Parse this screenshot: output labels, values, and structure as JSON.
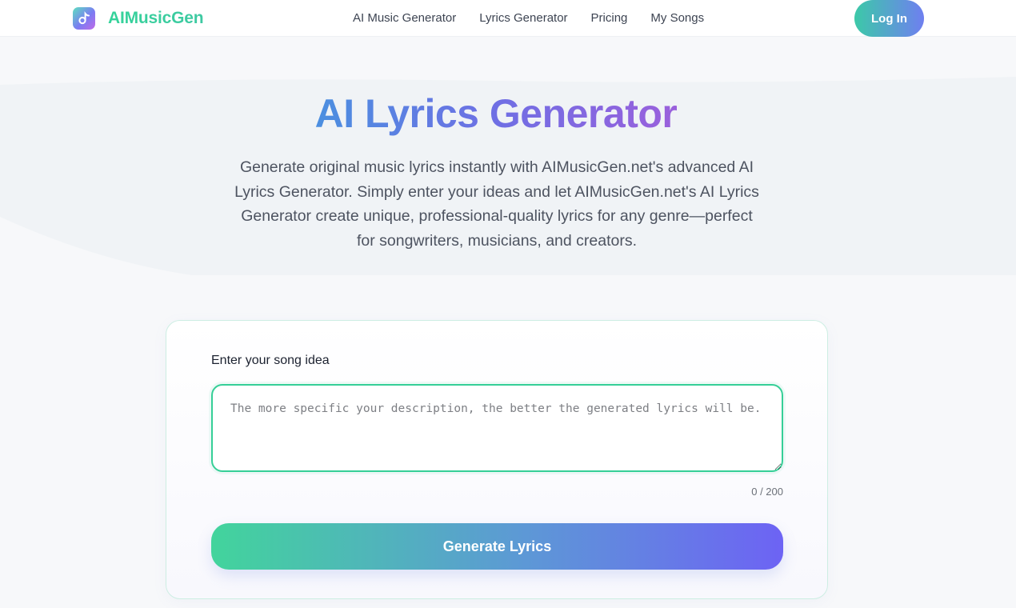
{
  "header": {
    "logo_text": "AIMusicGen",
    "logo_icon": "music-note-app-icon",
    "nav": [
      {
        "label": "AI Music Generator"
      },
      {
        "label": "Lyrics Generator"
      },
      {
        "label": "Pricing"
      },
      {
        "label": "My Songs"
      }
    ],
    "login_label": "Log In"
  },
  "hero": {
    "title": "AI Lyrics Generator",
    "description": "Generate original music lyrics instantly with AIMusicGen.net's advanced AI Lyrics Generator. Simply enter your ideas and let AIMusicGen.net's AI Lyrics Generator create unique, professional-quality lyrics for any genre—perfect for songwriters, musicians, and creators."
  },
  "form": {
    "label": "Enter your song idea",
    "placeholder": "The more specific your description, the better the generated lyrics will be.",
    "value": "",
    "char_count": "0 / 200",
    "submit_label": "Generate Lyrics"
  },
  "colors": {
    "brand_green": "#34d39a",
    "brand_purple": "#6d63f4",
    "input_border": "#36cf97"
  }
}
